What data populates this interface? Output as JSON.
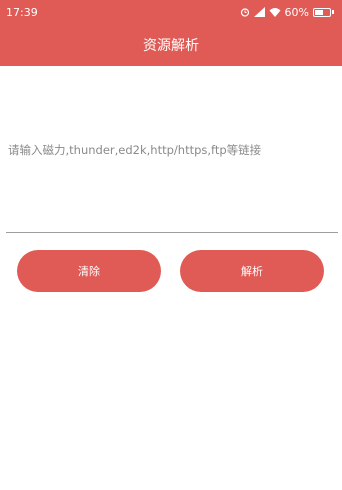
{
  "status_bar": {
    "time": "17:39",
    "battery_percent": "60%",
    "battery_level": 0.6,
    "icons": [
      "alarm-icon",
      "signal-icon",
      "wifi-icon",
      "battery-icon"
    ]
  },
  "header": {
    "title": "资源解析"
  },
  "input": {
    "value": "",
    "placeholder": "请输入磁力,thunder,ed2k,http/https,ftp等链接"
  },
  "buttons": {
    "clear_label": "清除",
    "parse_label": "解析"
  },
  "colors": {
    "accent": "#e05b55",
    "background": "#ffffff"
  }
}
